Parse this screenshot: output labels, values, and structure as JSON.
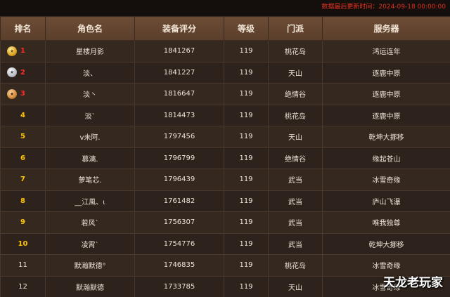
{
  "update_time": "数据最后更新时间：2024-09-18 00:00:00",
  "headers": {
    "rank": "排名",
    "name": "角色名",
    "score": "装备评分",
    "level": "等级",
    "sect": "门派",
    "server": "服务器"
  },
  "rows": [
    {
      "rank": "1",
      "medal": "gold",
      "name": "星楼月影",
      "score": "1841267",
      "level": "119",
      "sect": "桃花岛",
      "server": "鸿运连年"
    },
    {
      "rank": "2",
      "medal": "silver",
      "name": "淡、",
      "score": "1841227",
      "level": "119",
      "sect": "天山",
      "server": "逐鹿中原"
    },
    {
      "rank": "3",
      "medal": "bronze",
      "name": "淡丶",
      "score": "1816647",
      "level": "119",
      "sect": "绝情谷",
      "server": "逐鹿中原"
    },
    {
      "rank": "4",
      "medal": "",
      "name": "淡`",
      "score": "1814473",
      "level": "119",
      "sect": "桃花岛",
      "server": "逐鹿中原"
    },
    {
      "rank": "5",
      "medal": "",
      "name": "v未阿.",
      "score": "1797456",
      "level": "119",
      "sect": "天山",
      "server": "乾坤大挪移"
    },
    {
      "rank": "6",
      "medal": "",
      "name": "慕漓.",
      "score": "1796799",
      "level": "119",
      "sect": "绝情谷",
      "server": "缘起苍山"
    },
    {
      "rank": "7",
      "medal": "",
      "name": "萝笔芯.",
      "score": "1796439",
      "level": "119",
      "sect": "武当",
      "server": "冰雪奇缘"
    },
    {
      "rank": "8",
      "medal": "",
      "name": "__江風、ι",
      "score": "1761482",
      "level": "119",
      "sect": "武当",
      "server": "庐山飞瀑"
    },
    {
      "rank": "9",
      "medal": "",
      "name": "若风`",
      "score": "1756307",
      "level": "119",
      "sect": "武当",
      "server": "唯我独尊"
    },
    {
      "rank": "10",
      "medal": "",
      "name": "凌霄`",
      "score": "1754776",
      "level": "119",
      "sect": "武当",
      "server": "乾坤大挪移"
    },
    {
      "rank": "11",
      "medal": "",
      "name": "默瀚默德°",
      "score": "1746835",
      "level": "119",
      "sect": "桃花岛",
      "server": "冰雪奇缘"
    },
    {
      "rank": "12",
      "medal": "",
      "name": "默瀚默德",
      "score": "1733785",
      "level": "119",
      "sect": "天山",
      "server": "冰雪奇缘"
    }
  ],
  "watermark": "天龙老玩家",
  "colors": {
    "top3_rank": "#ff2a2a",
    "rank_4_to_10": "#ffc400",
    "update_time": "#e0301e"
  }
}
